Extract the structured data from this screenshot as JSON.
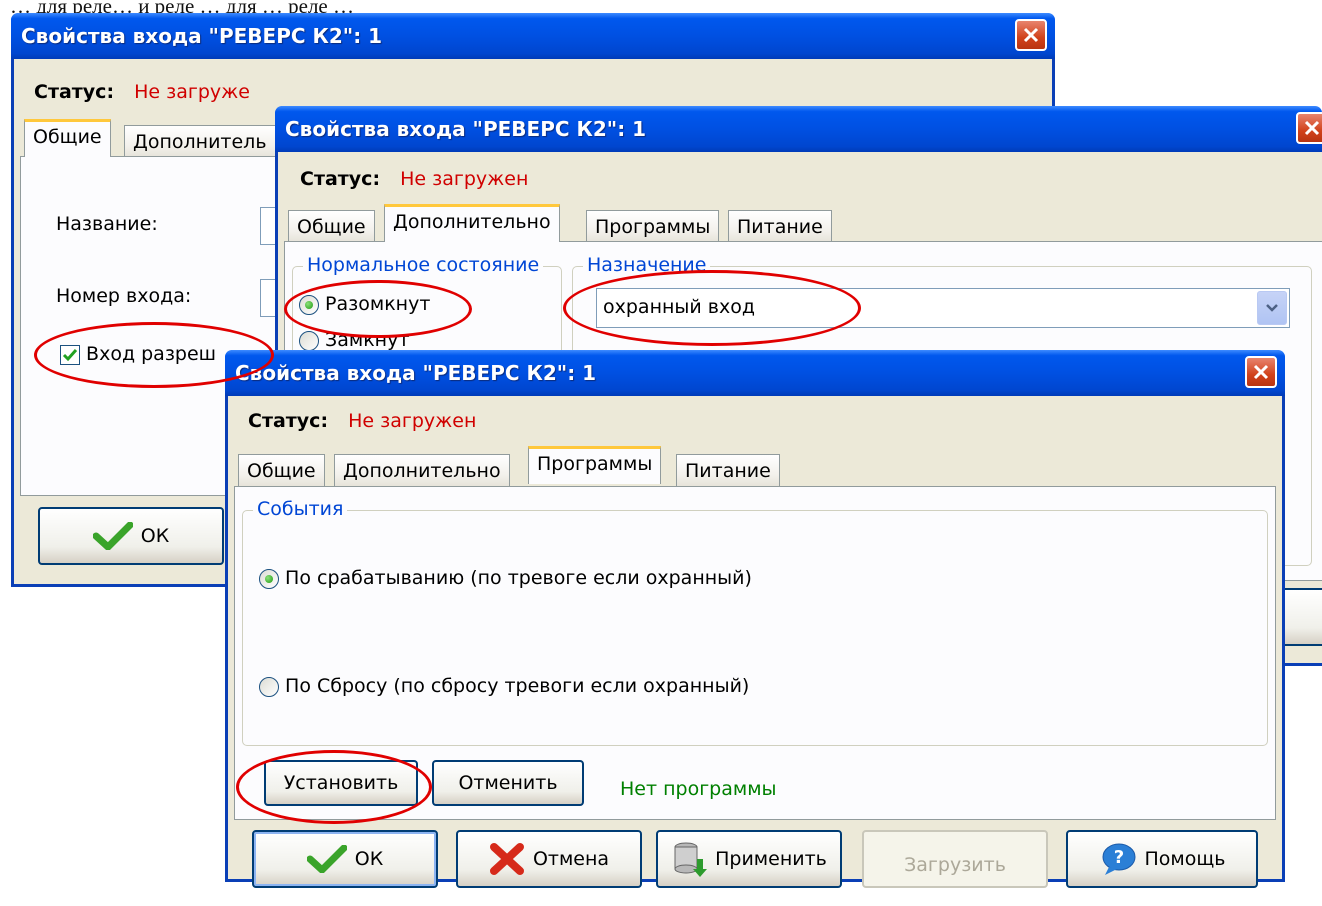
{
  "caption": "… для реле… и реле … для … реле …",
  "window_title": "Свойства входа \"РЕВЕРС К2\": 1",
  "status": {
    "label": "Статус:",
    "value": "Не загружен",
    "value_truncated": "Не загруже"
  },
  "tabs": {
    "general": "Общие",
    "additional": "Дополнительно",
    "additional_truncated": "Дополнитель",
    "programs": "Программы",
    "power": "Питание"
  },
  "general_tab": {
    "name_label": "Название:",
    "input_number_label": "Номер входа:",
    "input_enabled_label": "Вход разреш",
    "input_enabled_checked": true
  },
  "additional_tab": {
    "normal_state_title": "Нормальное состояние",
    "open_label": "Разомкнут",
    "closed_label": "Замкнут",
    "purpose_title": "Назначение",
    "purpose_value": "охранный вход"
  },
  "programs_tab": {
    "events_title": "События",
    "on_trigger_label": "По срабатыванию (по тревоге если охранный)",
    "on_reset_label": "По Сбросу  (по сбросу тревоги если охранный)",
    "on_trigger_selected": true,
    "set_button": "Установить",
    "cancel_program_button": "Отменить",
    "program_status": "Нет программы"
  },
  "buttons": {
    "ok": "ОК",
    "cancel": "Отмена",
    "apply": "Применить",
    "load": "Загрузить",
    "help": "Помощь"
  },
  "colors": {
    "title_bar": "#0054e3",
    "status_value": "#d00000",
    "group_title": "#0046d5",
    "program_status": "#008000",
    "highlight_ellipse": "#e00000"
  }
}
